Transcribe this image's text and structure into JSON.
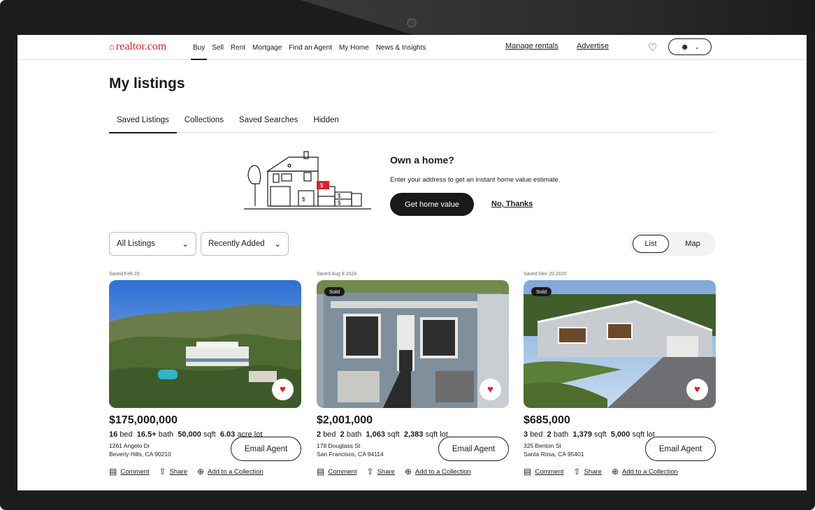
{
  "header": {
    "logo": "realtor.com",
    "nav": [
      "Buy",
      "Sell",
      "Rent",
      "Mortgage",
      "Find an Agent",
      "My Home",
      "News & Insights"
    ],
    "active_nav": "Buy",
    "manage_rentals": "Manage rentals",
    "advertise": "Advertise"
  },
  "page": {
    "title": "My listings",
    "tabs": [
      "Saved Listings",
      "Collections",
      "Saved Searches",
      "Hidden"
    ],
    "active_tab": "Saved Listings"
  },
  "promo": {
    "title": "Own a home?",
    "text": "Enter your address to get an instant home value estimate.",
    "cta": "Get home value",
    "dismiss": "No, Thanks"
  },
  "filters": {
    "listing_filter": "All Listings",
    "sort": "Recently Added",
    "view_options": [
      "List",
      "Map"
    ],
    "selected_view": "List"
  },
  "cards": [
    {
      "saved": "Saved Feb 20",
      "sold": "",
      "price": "$175,000,000",
      "beds": "16",
      "baths": "16.5+",
      "sqft": "50,000",
      "lot": "6.03",
      "lot_unit": "acre lot",
      "street": "1261 Angelo Dr",
      "city": "Beverly Hills, CA 90210"
    },
    {
      "saved": "Saved Aug 9 2024",
      "sold": "Sold",
      "price": "$2,001,000",
      "beds": "2",
      "baths": "2",
      "sqft": "1,063",
      "lot": "2,383",
      "lot_unit": "sqft lot",
      "street": "178 Douglass St",
      "city": "San Francisco, CA 94114"
    },
    {
      "saved": "Saved Dec 20 2020",
      "sold": "Sold",
      "price": "$685,000",
      "beds": "3",
      "baths": "2",
      "sqft": "1,379",
      "lot": "5,000",
      "lot_unit": "sqft lot",
      "street": "325 Benton St",
      "city": "Santa Rosa, CA 95401"
    }
  ],
  "labels": {
    "bed": "bed",
    "bath": "bath",
    "sqft": "sqft",
    "email_agent": "Email Agent",
    "comment": "Comment",
    "share": "Share",
    "add_collection": "Add to a Collection"
  },
  "icons": {
    "favorite": "heart-icon",
    "account": "user-icon",
    "comment": "comment-icon",
    "share": "share-icon",
    "add": "plus-circle-icon"
  },
  "colors": {
    "brand": "#d92228",
    "dark": "#1a1a1a"
  }
}
